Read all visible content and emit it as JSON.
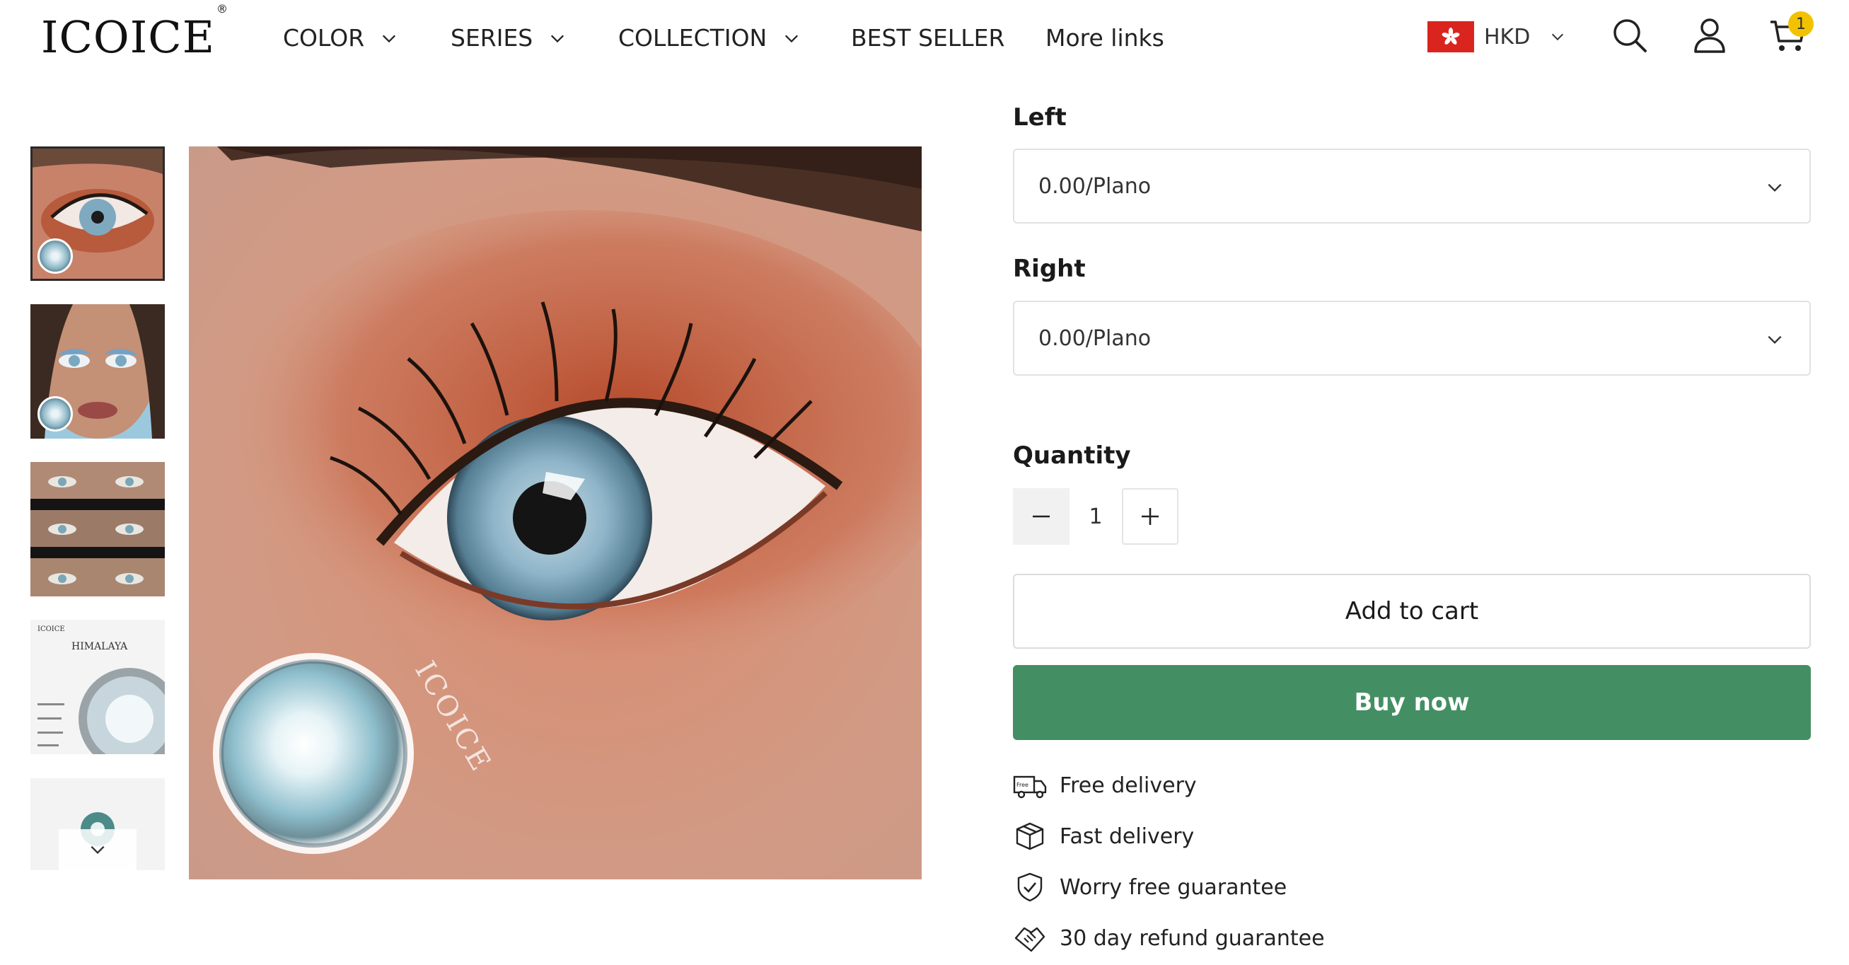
{
  "header": {
    "logo": "ICOICE",
    "logo_mark": "®",
    "nav": [
      {
        "label": "COLOR",
        "has_dropdown": true
      },
      {
        "label": "SERIES",
        "has_dropdown": true
      },
      {
        "label": "COLLECTION",
        "has_dropdown": true
      },
      {
        "label": "BEST SELLER",
        "has_dropdown": false
      },
      {
        "label": "More links",
        "has_dropdown": false
      }
    ],
    "currency": "HKD",
    "cart_count": "1",
    "icons": [
      "hong-kong-flag-icon",
      "search-icon",
      "account-icon",
      "cart-icon"
    ]
  },
  "gallery": {
    "thumb4_brand": "ICOICE",
    "thumb4_title": "HIMALAYA",
    "watermark": "ICOICE"
  },
  "options": {
    "left_label": "Left",
    "left_value": "0.00/Plano",
    "right_label": "Right",
    "right_value": "0.00/Plano",
    "quantity_label": "Quantity",
    "quantity_value": "1"
  },
  "actions": {
    "add_to_cart": "Add to cart",
    "buy_now": "Buy now"
  },
  "features": [
    {
      "icon": "delivery-truck-icon",
      "label": "Free delivery"
    },
    {
      "icon": "package-box-icon",
      "label": "Fast delivery"
    },
    {
      "icon": "shield-check-icon",
      "label": "Worry free guarantee"
    },
    {
      "icon": "handshake-icon",
      "label": "30 day refund guarantee"
    }
  ],
  "colors": {
    "buy_now_bg": "#438f63",
    "cart_badge": "#f2c200",
    "flag_red": "#d9251d"
  }
}
